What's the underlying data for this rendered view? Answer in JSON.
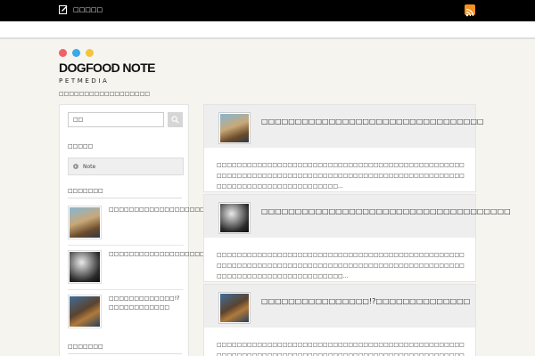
{
  "topbar": {
    "edit_label": "□□□□□"
  },
  "site": {
    "logo": "DOGFOOD NOTE",
    "tagline": "PETMEDIA",
    "description": "□□□□□□□□□□□□□□□□□□",
    "dot_colors": [
      "#f0616a",
      "#3aa9e6",
      "#f3c43f"
    ]
  },
  "sidebar": {
    "search": {
      "value": "□□",
      "placeholder": ""
    },
    "categories_title": "□□□□□",
    "category_item": "Note",
    "recent_title": "□□□□□□□",
    "recent_items": [
      {
        "text": "□□□□□□□□□□□□□□□□□□□□□□□□□□"
      },
      {
        "text": "□□□□□□□□□□□□□□□□□□□□□□□□□□□□□□□"
      },
      {
        "text": "□□□□□□□□□□□□□!?□□□□□□□□□□□□"
      }
    ],
    "bottom_title": "□□□□□□□"
  },
  "posts": [
    {
      "title": "□□□□□□□□□□□□□□□□□□□□□□□□□□□□□□□□□",
      "excerpt": "□□□□□□□□□□□□□□□□□□□□□□□□□□□□□□□□□□□□□□□□□□□□□□□□□□□□□□□□□□□□□□□□□□□□□□□□□□□□□□□□□□□□□□□□□□□□□□□□□□□□□□□□□□□□□□□□□□□□□□□□□□..."
    },
    {
      "title": "□□□□□□□□□□□□□□□□□□□□□□□□□□□□□□□□□□□□□",
      "excerpt": "□□□□□□□□□□□□□□□□□□□□□□□□□□□□□□□□□□□□□□□□□□□□□□□□□□□□□□□□□□□□□□□□□□□□□□□□□□□□□□□□□□□□□□□□□□□□□□□□□□□□□□□□□□□□□□□□□□□□□□□□□□□..."
    },
    {
      "title": "□□□□□□□□□□□□□□□□!?□□□□□□□□□□□□□□",
      "excerpt": "□□□□□□□□□□□□□□□□□□□□□□□□□□□□□□□□□□□□□□□□□□□□□□□□□□□□□□□□□□□□□□□□□□□□□□□□□□□□□□□□□□□□□□□□□□□□□□□□□□□□□□□□□□□□□□□□□□□□□□□□□□□□..."
    }
  ]
}
